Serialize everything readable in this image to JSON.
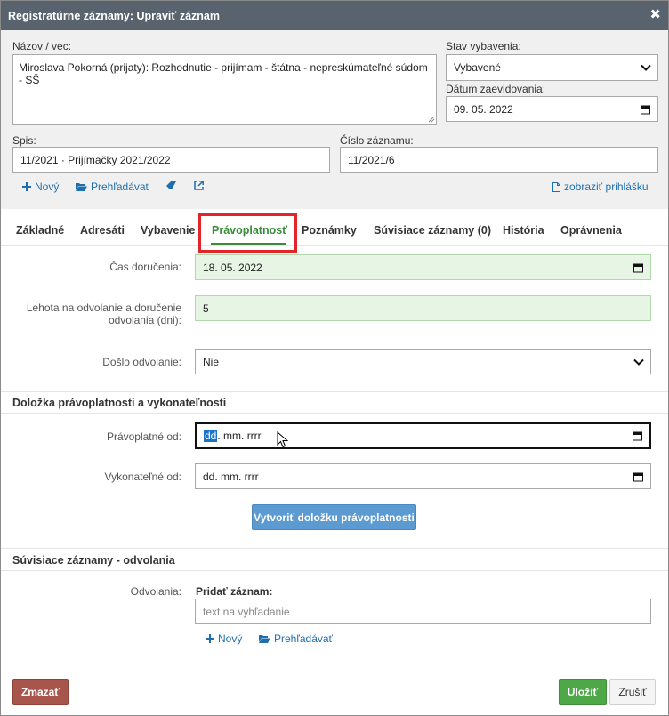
{
  "dialog": {
    "title": "Registratúrne záznamy: Upraviť záznam",
    "close_glyph": "✖"
  },
  "header": {
    "nazov_label": "Názov / vec:",
    "nazov_value": "Miroslava Pokorná (prijaty): Rozhodnutie - prijímam - štátna - nepreskúmateľné súdom - SŠ",
    "stav_label": "Stav vybavenia:",
    "stav_value": "Vybavené",
    "datum_label": "Dátum zaevidovania:",
    "datum_value": "09. 05. 2022",
    "spis_label": "Spis:",
    "spis_value": "11/2021 · Prijímačky 2021/2022",
    "cislo_label": "Číslo záznamu:",
    "cislo_value": "11/2021/6",
    "novy_link": "Nový",
    "prehladavat_link": "Prehľadávať",
    "zobrazit_link": "zobraziť prihlášku"
  },
  "tabs": [
    {
      "label": "Základné"
    },
    {
      "label": "Adresáti"
    },
    {
      "label": "Vybavenie"
    },
    {
      "label": "Právoplatnosť"
    },
    {
      "label": "Poznámky"
    },
    {
      "label": "Súvisiace záznamy (0)"
    },
    {
      "label": "História"
    },
    {
      "label": "Oprávnenia"
    }
  ],
  "pravoplatnost": {
    "cas_label": "Čas doručenia:",
    "cas_value": "18. 05. 2022",
    "lehota_label_1": "Lehota na odvolanie a doručenie",
    "lehota_label_2": "odvolania (dni):",
    "lehota_value": "5",
    "doslo_label": "Došlo odvolanie:",
    "doslo_value": "Nie",
    "dolozka_title": "Doložka právoplatnosti a vykonateľnosti",
    "pravoplatne_label": "Právoplatné od:",
    "pravoplatne_dd": "dd",
    "pravoplatne_rest": ". mm. rrrr",
    "vykonatelne_label": "Vykonateľné od:",
    "vykonatelne_value": "dd. mm. rrrr",
    "vytvorit_button": "Vytvoriť doložku právoplatnosti"
  },
  "suvisiace": {
    "title": "Súvisiace záznamy - odvolania",
    "odvolania_label": "Odvolania:",
    "pridat_label": "Pridať záznam:",
    "search_placeholder": "text na vyhľadanie",
    "novy_link": "Nový",
    "prehladavat_link": "Prehľadávať"
  },
  "footer": {
    "zmazat": "Zmazať",
    "ulozit": "Uložiť",
    "zrusit": "Zrušiť"
  },
  "colors": {
    "titlebar": "#58636e",
    "link": "#1e6fb0",
    "active_tab": "#3a8c3a",
    "highlight": "#e3242b",
    "success": "#4fa848",
    "danger": "#a8564b",
    "primary": "#5b9bd1"
  }
}
